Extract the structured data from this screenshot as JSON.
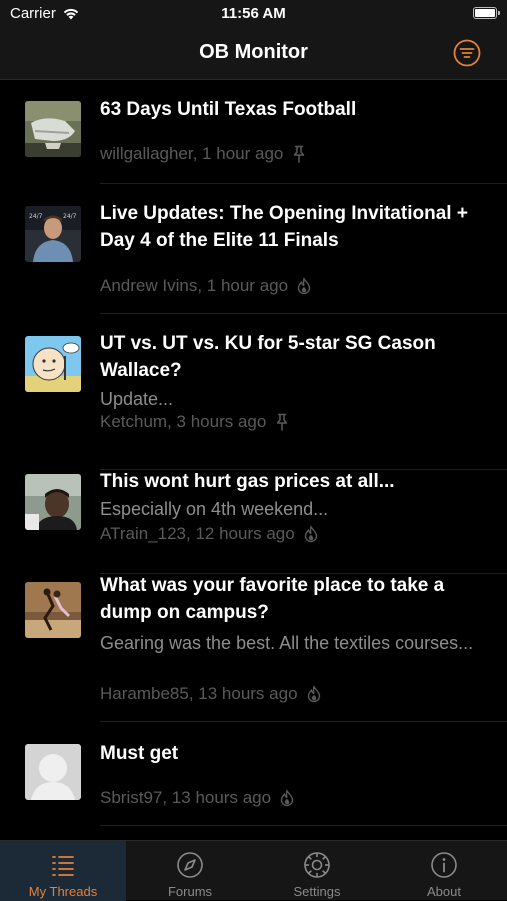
{
  "status_bar": {
    "carrier": "Carrier",
    "time": "11:56 AM"
  },
  "nav": {
    "title": "OB Monitor",
    "filter_icon": "filter-lines-icon",
    "accent": "#e2823a"
  },
  "threads": [
    {
      "title": "63 Days Until Texas Football",
      "preview": "",
      "author_time": "willgallagher, 1 hour ago",
      "badge": "pin-icon",
      "thumb": "cleats-photo"
    },
    {
      "title": "Live Updates: The Opening Invitational + Day 4 of the Elite 11 Finals",
      "preview": "",
      "author_time": "Andrew Ivins, 1 hour ago",
      "badge": "flame-icon",
      "thumb": "reporter-photo"
    },
    {
      "title": "UT vs. UT vs. KU for 5-star SG Cason Wallace?",
      "preview": "Update...",
      "author_time": "Ketchum, 3 hours ago",
      "badge": "pin-icon",
      "thumb": "cartoon-avatar"
    },
    {
      "title": "This wont hurt gas prices at all...",
      "preview": "Especially on 4th weekend...",
      "author_time": "ATrain_123, 12 hours ago",
      "badge": "flame-icon",
      "thumb": "player-photo"
    },
    {
      "title": "What was your favorite place to take a dump on campus?",
      "preview": "Gearing was the best. All the textiles courses...",
      "author_time": "Harambe85, 13 hours ago",
      "badge": "flame-icon",
      "thumb": "dancing-photo"
    },
    {
      "title": "Must get",
      "preview": "",
      "author_time": "Sbrist97, 13 hours ago",
      "badge": "flame-icon",
      "thumb": "default-avatar"
    }
  ],
  "tabs": [
    {
      "label": "My Threads",
      "icon": "list-icon",
      "selected": true
    },
    {
      "label": "Forums",
      "icon": "compass-icon",
      "selected": false
    },
    {
      "label": "Settings",
      "icon": "gear-icon",
      "selected": false
    },
    {
      "label": "About",
      "icon": "info-icon",
      "selected": false
    }
  ]
}
